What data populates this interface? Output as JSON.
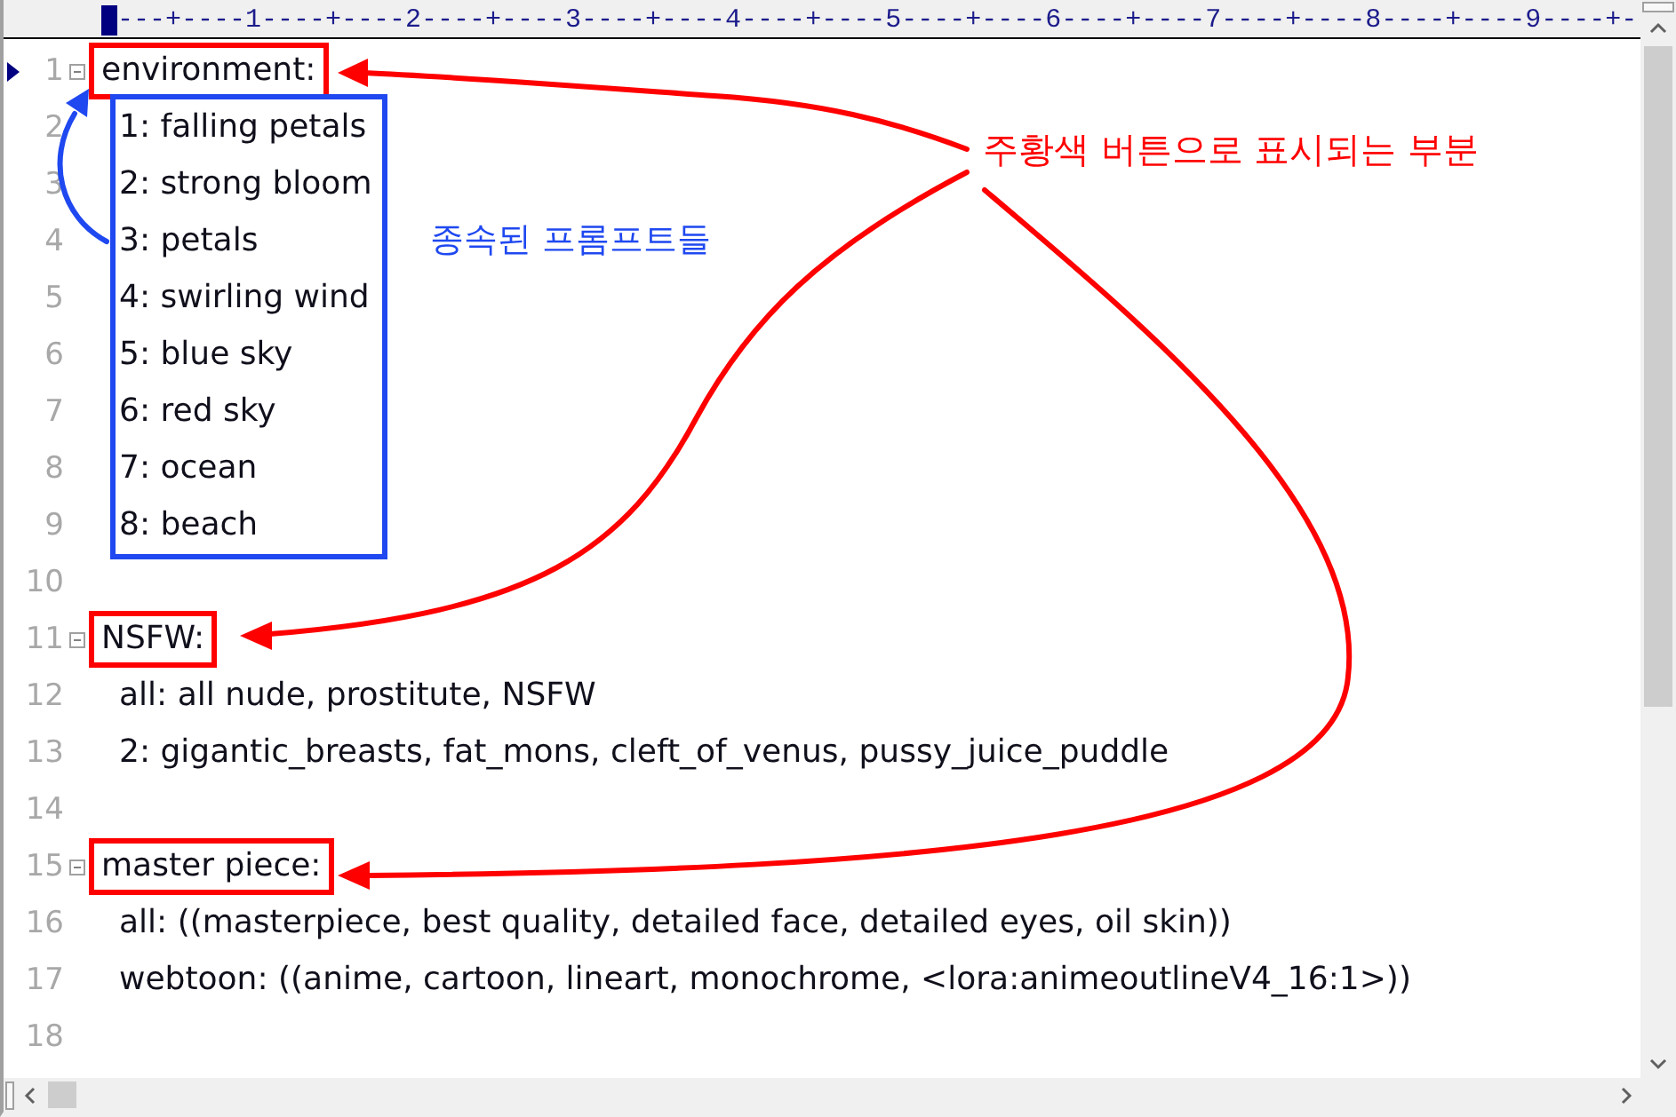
{
  "ruler": {
    "text": "---+----1----+----2----+----3----+----4----+----5----+----6----+----7----+----8----+----9----+-"
  },
  "editor": {
    "lines": [
      {
        "number": "1",
        "text": "environment:",
        "current": true,
        "fold": true,
        "boxed": true,
        "children_boxed": true,
        "children": [
          {
            "number": "2",
            "text": "1: falling petals",
            "current": false
          },
          {
            "number": "3",
            "text": "2: strong bloom",
            "current": false
          },
          {
            "number": "4",
            "text": "3: petals",
            "current": false
          },
          {
            "number": "5",
            "text": "4: swirling wind",
            "current": false
          },
          {
            "number": "6",
            "text": "5: blue sky",
            "current": false
          },
          {
            "number": "7",
            "text": "6: red sky",
            "current": false
          },
          {
            "number": "8",
            "text": "7: ocean",
            "current": false
          },
          {
            "number": "9",
            "text": "8: beach",
            "current": false
          }
        ]
      },
      {
        "number": "10",
        "current": false,
        "fold": false,
        "boxed": false
      },
      {
        "number": "11",
        "text": "NSFW:",
        "current": false,
        "fold": true,
        "boxed": true,
        "children_boxed": false,
        "children": [
          {
            "number": "12",
            "text": "all: all nude, prostitute, NSFW",
            "current": false
          },
          {
            "number": "13",
            "text": "2: gigantic_breasts, fat_mons, cleft_of_venus, pussy_juice_puddle",
            "current": false
          }
        ]
      },
      {
        "number": "14",
        "current": false,
        "fold": false,
        "boxed": false
      },
      {
        "number": "15",
        "text": "master piece:",
        "current": false,
        "fold": true,
        "boxed": true,
        "children_boxed": false,
        "children": [
          {
            "number": "16",
            "text": "all: ((masterpiece, best quality, detailed face, detailed eyes, oil skin))",
            "current": false
          },
          {
            "number": "17",
            "text": "webtoon: ((anime, cartoon, lineart, monochrome, <lora:animeoutlineV4_16:1>))",
            "current": false
          }
        ]
      },
      {
        "number": "18",
        "current": false,
        "fold": false,
        "boxed": false
      }
    ]
  },
  "annotations": [
    {
      "kind": "headings",
      "text": "주황색 버튼으로 표시되는 부분",
      "color": "#ff0000"
    },
    {
      "kind": "group",
      "text": "종속된 프롬프트들",
      "color": "#1f48f0"
    }
  ]
}
